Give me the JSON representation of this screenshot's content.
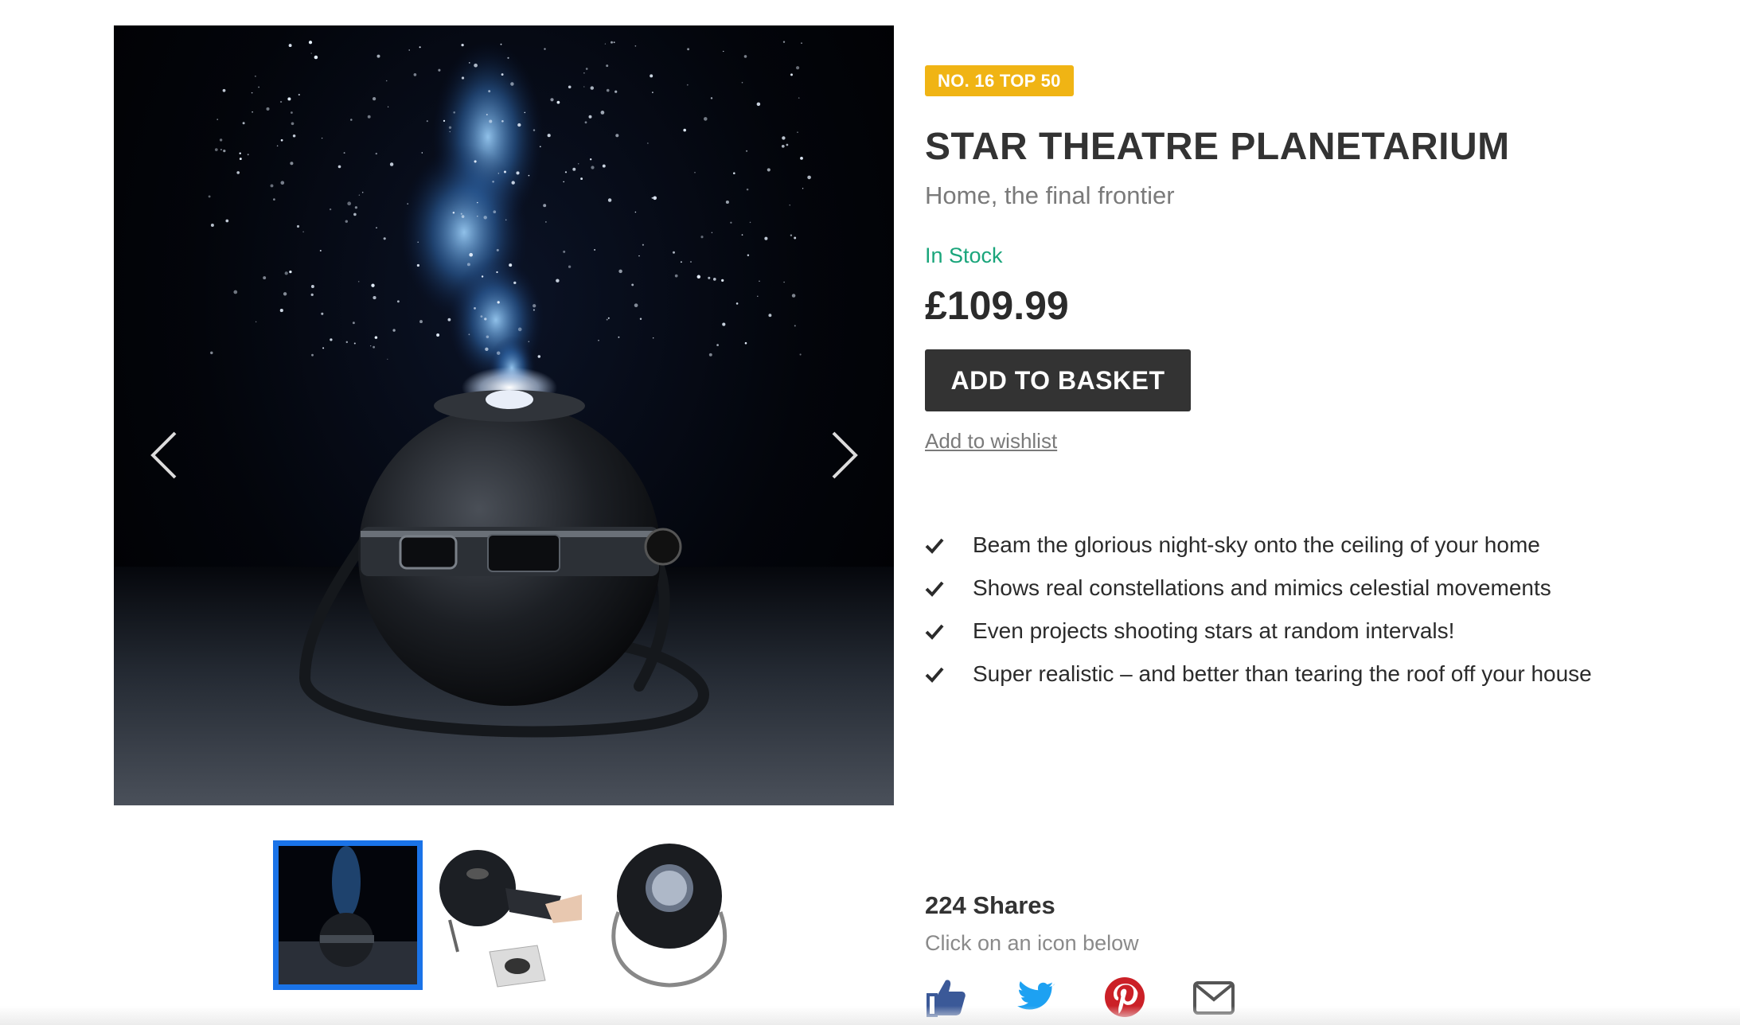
{
  "product": {
    "badge": "NO. 16 TOP 50",
    "title": "STAR THEATRE PLANETARIUM",
    "subtitle": "Home, the final frontier",
    "stock": "In Stock",
    "price": "£109.99",
    "add_to_basket": "ADD TO BASKET",
    "wishlist": "Add to wishlist",
    "features": [
      "Beam the glorious night-sky onto the ceiling of your home",
      "Shows real constellations and mimics celestial movements",
      "Even projects shooting stars at random intervals!",
      "Super realistic – and better than tearing the roof off your house"
    ]
  },
  "gallery": {
    "prev_icon": "chevron-left-icon",
    "next_icon": "chevron-right-icon",
    "thumbnails_count": 3,
    "active_thumbnail": 1
  },
  "shares": {
    "count": "224 Shares",
    "hint": "Click on an icon below",
    "icons": [
      "facebook-like-icon",
      "twitter-icon",
      "pinterest-icon",
      "email-icon"
    ]
  },
  "colors": {
    "badge": "#f0b414",
    "stock": "#1aa57b",
    "button": "#333333",
    "active_thumb": "#1a73e8",
    "facebook": "#3b5998",
    "twitter": "#1da1f2",
    "pinterest": "#cb2027",
    "email": "#555555"
  }
}
